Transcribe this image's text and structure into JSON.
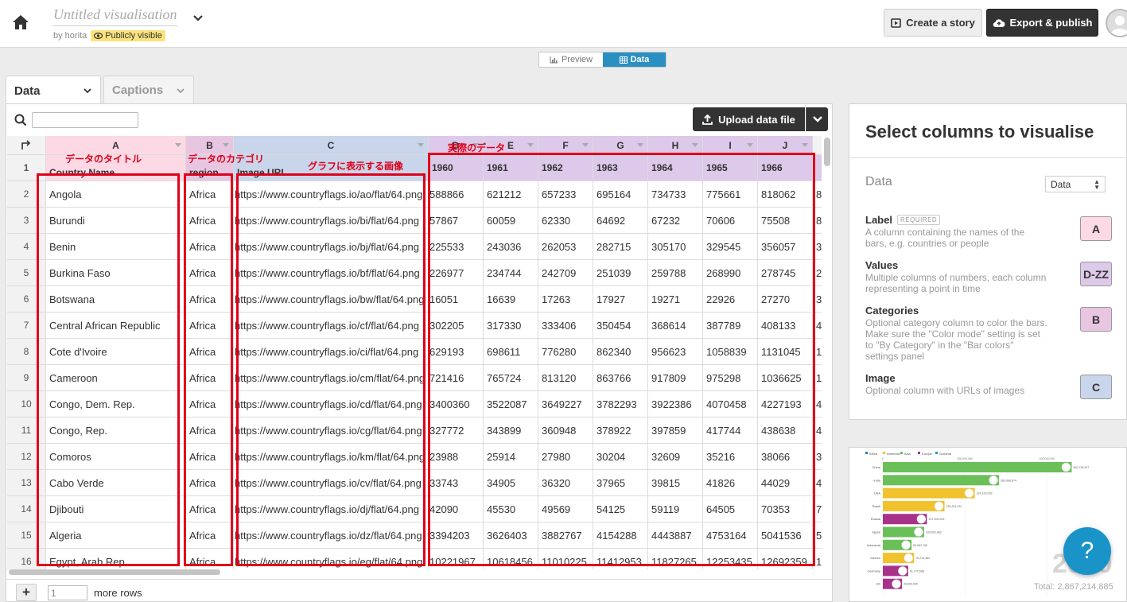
{
  "header": {
    "vis_title": "Untitled visualisation",
    "by_author": "by horita",
    "visibility": "Publicly visible",
    "create_story": "Create a story",
    "export_publish": "Export & publish"
  },
  "mode_toggle": {
    "preview": "Preview",
    "data": "Data",
    "active": "Data"
  },
  "tabs": [
    {
      "label": "Data",
      "active": true
    },
    {
      "label": "Captions",
      "active": false
    }
  ],
  "toolbar": {
    "search_placeholder": "",
    "upload_label": "Upload data file"
  },
  "columns": {
    "letters": [
      "A",
      "B",
      "C",
      "D",
      "E",
      "F",
      "G",
      "H",
      "I",
      "J"
    ],
    "headers": [
      "Country Name",
      "region",
      "Image URL",
      "1960",
      "1961",
      "1962",
      "1963",
      "1964",
      "1965",
      "1966"
    ]
  },
  "rows": [
    {
      "n": "2",
      "name": "Angola",
      "region": "Africa",
      "url": "https://www.countryflags.io/ao/flat/64.png",
      "v": [
        "588866",
        "621212",
        "657233",
        "695164",
        "734733",
        "775661",
        "818062"
      ],
      "last": "8"
    },
    {
      "n": "3",
      "name": "Burundi",
      "region": "Africa",
      "url": "https://www.countryflags.io/bi/flat/64.png",
      "v": [
        "57867",
        "60059",
        "62330",
        "64692",
        "67232",
        "70606",
        "75508"
      ],
      "last": "8"
    },
    {
      "n": "4",
      "name": "Benin",
      "region": "Africa",
      "url": "https://www.countryflags.io/bj/flat/64.png",
      "v": [
        "225533",
        "243036",
        "262053",
        "282715",
        "305170",
        "329545",
        "356057"
      ],
      "last": "3"
    },
    {
      "n": "5",
      "name": "Burkina Faso",
      "region": "Africa",
      "url": "https://www.countryflags.io/bf/flat/64.png",
      "v": [
        "226977",
        "234744",
        "242709",
        "251039",
        "259788",
        "268990",
        "278745"
      ],
      "last": "2"
    },
    {
      "n": "6",
      "name": "Botswana",
      "region": "Africa",
      "url": "https://www.countryflags.io/bw/flat/64.png",
      "v": [
        "16051",
        "16639",
        "17263",
        "17927",
        "19271",
        "22926",
        "27270"
      ],
      "last": "3"
    },
    {
      "n": "7",
      "name": "Central African Republic",
      "region": "Africa",
      "url": "https://www.countryflags.io/cf/flat/64.png",
      "v": [
        "302205",
        "317330",
        "333406",
        "350454",
        "368614",
        "387789",
        "408133"
      ],
      "last": "4"
    },
    {
      "n": "8",
      "name": "Cote d'Ivoire",
      "region": "Africa",
      "url": "https://www.countryflags.io/ci/flat/64.png",
      "v": [
        "629193",
        "698611",
        "776280",
        "862340",
        "956623",
        "1058839",
        "1131045"
      ],
      "last": "1"
    },
    {
      "n": "9",
      "name": "Cameroon",
      "region": "Africa",
      "url": "https://www.countryflags.io/cm/flat/64.png",
      "v": [
        "721416",
        "765724",
        "813120",
        "863766",
        "917809",
        "975298",
        "1036625"
      ],
      "last": "1"
    },
    {
      "n": "10",
      "name": "Congo, Dem. Rep.",
      "region": "Africa",
      "url": "https://www.countryflags.io/cd/flat/64.png",
      "v": [
        "3400360",
        "3522087",
        "3649227",
        "3782293",
        "3922386",
        "4070458",
        "4227193"
      ],
      "last": "4"
    },
    {
      "n": "11",
      "name": "Congo, Rep.",
      "region": "Africa",
      "url": "https://www.countryflags.io/cg/flat/64.png",
      "v": [
        "327772",
        "343899",
        "360948",
        "378922",
        "397859",
        "417744",
        "438638"
      ],
      "last": "4"
    },
    {
      "n": "12",
      "name": "Comoros",
      "region": "Africa",
      "url": "https://www.countryflags.io/km/flat/64.png",
      "v": [
        "23988",
        "25914",
        "27980",
        "30204",
        "32609",
        "35216",
        "38066"
      ],
      "last": "3"
    },
    {
      "n": "13",
      "name": "Cabo Verde",
      "region": "Africa",
      "url": "https://www.countryflags.io/cv/flat/64.png",
      "v": [
        "33743",
        "34905",
        "36320",
        "37965",
        "39815",
        "41826",
        "44029"
      ],
      "last": "4"
    },
    {
      "n": "14",
      "name": "Djibouti",
      "region": "Africa",
      "url": "https://www.countryflags.io/dj/flat/64.png",
      "v": [
        "42090",
        "45530",
        "49569",
        "54125",
        "59119",
        "64505",
        "70353"
      ],
      "last": "7"
    },
    {
      "n": "15",
      "name": "Algeria",
      "region": "Africa",
      "url": "https://www.countryflags.io/dz/flat/64.png",
      "v": [
        "3394203",
        "3626403",
        "3882767",
        "4154288",
        "4443887",
        "4753164",
        "5041536"
      ],
      "last": "5"
    },
    {
      "n": "16",
      "name": "Egypt, Arab Rep.",
      "region": "Africa",
      "url": "https://www.countryflags.io/eg/flat/64.png",
      "v": [
        "10221967",
        "10618456",
        "11010225",
        "11412953",
        "11827265",
        "12253435",
        "12692359"
      ],
      "last": "1"
    }
  ],
  "footer": {
    "add_symbol": "+",
    "rows_value": "1",
    "rows_label": "more rows"
  },
  "annotations": {
    "title_note": "データのタイトル",
    "category_note": "データのカテゴリ",
    "image_note": "グラフに表示する画像",
    "data_note": "実際のデータ"
  },
  "right_panel": {
    "title": "Select columns to visualise",
    "data_label": "Data",
    "data_select": "Data",
    "bindings": [
      {
        "name": "Label",
        "required": "REQUIRED",
        "desc": "A column containing the names of the bars, e.g. countries or people",
        "badge": "A",
        "color": "#fcd9e4"
      },
      {
        "name": "Values",
        "required": "",
        "desc": "Multiple columns of numbers, each column representing a point in time",
        "badge": "D-ZZ",
        "color": "#ddc9ea"
      },
      {
        "name": "Categories",
        "required": "",
        "desc": "Optional category column to color the bars. Make sure the \"Color mode\" setting is set to \"By Category\" in the \"Bar colors\" settings panel",
        "badge": "B",
        "color": "#e8c6e2"
      },
      {
        "name": "Image",
        "required": "",
        "desc": "Optional column with URLs of images",
        "badge": "C",
        "color": "#c9d5ea"
      }
    ]
  },
  "preview": {
    "legend": [
      "Africa",
      "Americas",
      "Asia",
      "Europe",
      "Oceania"
    ],
    "legend_colors": [
      "#2a7fc1",
      "#f2c12e",
      "#6bbf59",
      "#a8328a",
      "#1fa3a3"
    ],
    "axis_ticks": [
      "0",
      "200,000,000",
      "400,000,000"
    ],
    "year": "2000",
    "total": "Total: 2,867,214,885",
    "help": "?"
  },
  "chart_data": {
    "type": "bar",
    "categories": [
      "China",
      "India",
      "USA",
      "Brazil",
      "Russia",
      "Japan",
      "Indonesia",
      "Mexico",
      "Germany",
      "UK"
    ],
    "series": [
      {
        "values": [
          460138307,
          283088874,
          224100092,
          150324291,
          107304253,
          100602482,
          69962760,
          76210380,
          61770588,
          46603000
        ]
      }
    ],
    "value_labels": [
      "460,138,307",
      "283,088,874",
      "224,100,092",
      "150,324,291",
      "107,304,253",
      "100,602,482",
      "69,962,760",
      "76,210,380",
      "61,770,588",
      "46,603,000"
    ],
    "colors": [
      "#6bbf59",
      "#6bbf59",
      "#f2c12e",
      "#f2c12e",
      "#a8328a",
      "#6bbf59",
      "#6bbf59",
      "#f2c12e",
      "#a8328a",
      "#a8328a"
    ],
    "xlim": [
      0,
      500000000
    ]
  }
}
